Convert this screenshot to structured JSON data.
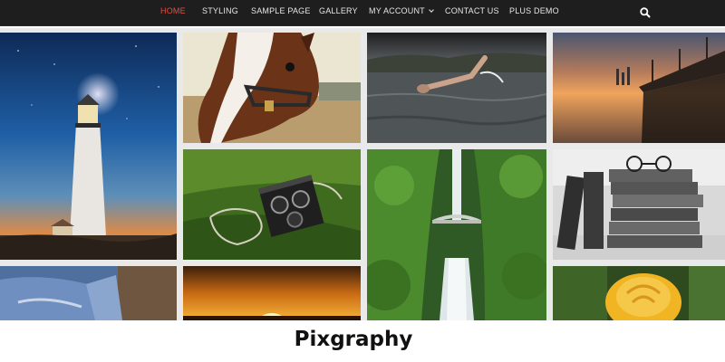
{
  "nav": {
    "items": [
      {
        "label": "HOME",
        "active": true
      },
      {
        "label": "STYLING"
      },
      {
        "label": "SAMPLE PAGE"
      },
      {
        "label": "GALLERY"
      },
      {
        "label": "MY ACCOUNT",
        "has_dropdown": true
      },
      {
        "label": "CONTACT US"
      },
      {
        "label": "PLUS DEMO"
      }
    ],
    "search_icon": "search-icon",
    "colors": {
      "bar": "#1e1e1e",
      "text": "#e6e6e6",
      "active": "#e2513f"
    }
  },
  "caption": "Pixgraphy"
}
